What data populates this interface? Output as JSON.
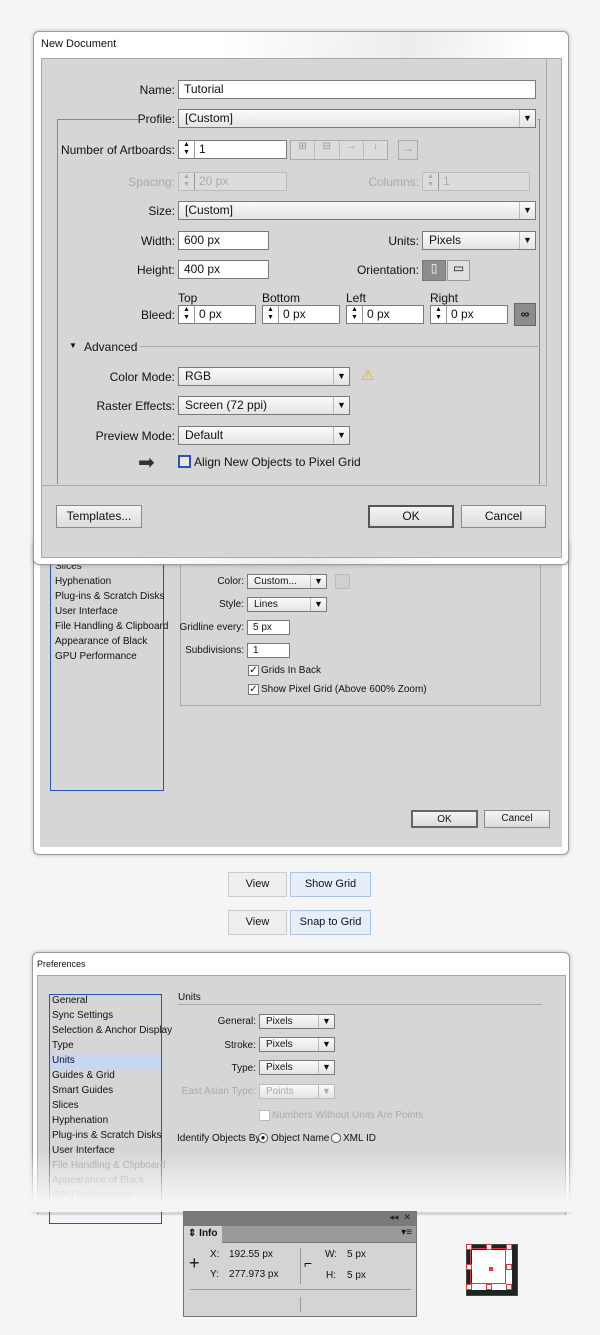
{
  "new_doc": {
    "title": "New Document",
    "name_label": "Name:",
    "name_value": "Tutorial",
    "profile_label": "Profile:",
    "profile_value": "[Custom]",
    "artboards_label": "Number of Artboards:",
    "artboards_value": "1",
    "spacing_label": "Spacing:",
    "spacing_value": "20 px",
    "columns_label": "Columns:",
    "columns_value": "1",
    "size_label": "Size:",
    "size_value": "[Custom]",
    "width_label": "Width:",
    "width_value": "600 px",
    "units_label": "Units:",
    "units_value": "Pixels",
    "height_label": "Height:",
    "height_value": "400 px",
    "orientation_label": "Orientation:",
    "bleed_label": "Bleed:",
    "bleed": [
      {
        "label": "Top",
        "value": "0 px"
      },
      {
        "label": "Bottom",
        "value": "0 px"
      },
      {
        "label": "Left",
        "value": "0 px"
      },
      {
        "label": "Right",
        "value": "0 px"
      }
    ],
    "advanced_label": "Advanced",
    "color_mode_label": "Color Mode:",
    "color_mode_value": "RGB",
    "raster_label": "Raster Effects:",
    "raster_value": "Screen (72 ppi)",
    "preview_label": "Preview Mode:",
    "preview_value": "Default",
    "align_label": "Align New Objects to Pixel Grid",
    "align_checked": false,
    "templates": "Templates...",
    "ok": "OK",
    "cancel": "Cancel"
  },
  "grid_prefs": {
    "list": [
      "Slices",
      "Hyphenation",
      "Plug-ins & Scratch Disks",
      "User Interface",
      "File Handling & Clipboard",
      "Appearance of Black",
      "GPU Performance"
    ],
    "color_label": "Color:",
    "color_value": "Custom...",
    "style_label": "Style:",
    "style_value": "Lines",
    "gridline_label": "Gridline every:",
    "gridline_value": "5 px",
    "subdiv_label": "Subdivisions:",
    "subdiv_value": "1",
    "grids_back": "Grids In Back",
    "grids_back_checked": true,
    "pixel_grid": "Show Pixel Grid (Above 600% Zoom)",
    "pixel_grid_checked": true,
    "ok": "OK",
    "cancel": "Cancel"
  },
  "menus": [
    {
      "menu": "View",
      "item": "Show Grid"
    },
    {
      "menu": "View",
      "item": "Snap to Grid"
    }
  ],
  "units_prefs": {
    "title": "Preferences",
    "list": [
      "General",
      "Sync Settings",
      "Selection & Anchor Display",
      "Type",
      "Units",
      "Guides & Grid",
      "Smart Guides",
      "Slices",
      "Hyphenation",
      "Plug-ins & Scratch Disks",
      "User Interface",
      "File Handling & Clipboard",
      "Appearance of Black",
      "GPU Performance"
    ],
    "selected": "Units",
    "section": "Units",
    "general_label": "General:",
    "general_value": "Pixels",
    "stroke_label": "Stroke:",
    "stroke_value": "Pixels",
    "type_label": "Type:",
    "type_value": "Pixels",
    "east_label": "East Asian Type:",
    "east_value": "Points",
    "numbers_label": "Numbers Without Units Are Points",
    "identify_label": "Identify Objects By:",
    "opt1": "Object Name",
    "opt2": "XML ID",
    "identify_selected": "Object Name"
  },
  "info": {
    "tab": "Info",
    "x_label": "X:",
    "x_value": "192.55 px",
    "y_label": "Y:",
    "y_value": "277.973 px",
    "w_label": "W:",
    "w_value": "5 px",
    "h_label": "H:",
    "h_value": "5 px"
  },
  "colors": {
    "accent": "#2a52be",
    "handle": "#e8373c",
    "selected_row": "#c7d7f2"
  }
}
